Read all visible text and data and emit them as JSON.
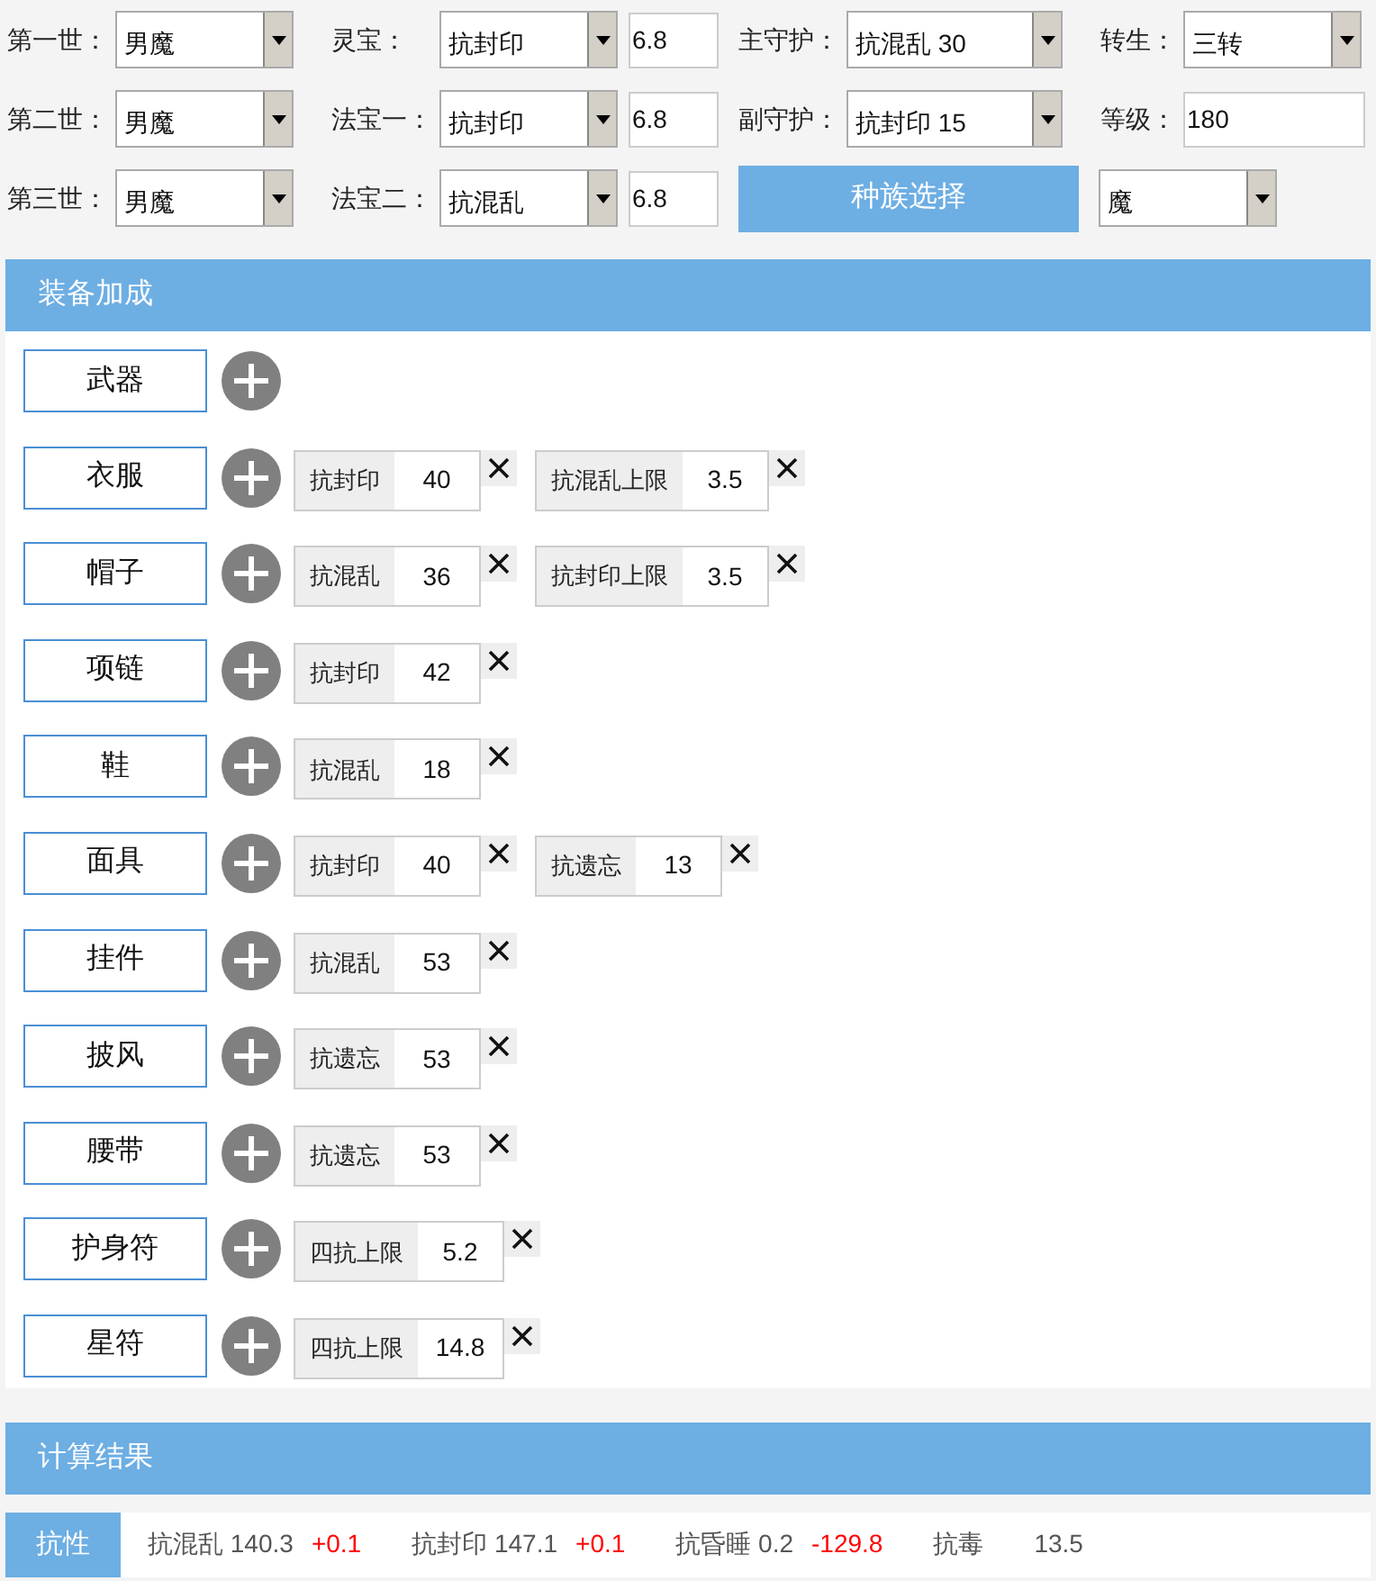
{
  "form": {
    "rows": [
      [
        {
          "kind": "label",
          "text": "第一世："
        },
        {
          "kind": "select",
          "text": "男魔"
        },
        {
          "kind": "label",
          "text": "灵宝："
        },
        {
          "kind": "select",
          "text": "抗封印"
        },
        {
          "kind": "input",
          "text": "6.8"
        },
        {
          "kind": "label",
          "text": "主守护："
        },
        {
          "kind": "wideselect",
          "text": "抗混乱 30"
        },
        {
          "kind": "label",
          "text": "转生："
        },
        {
          "kind": "select",
          "text": "三转"
        }
      ],
      [
        {
          "kind": "label",
          "text": "第二世："
        },
        {
          "kind": "select",
          "text": "男魔"
        },
        {
          "kind": "label",
          "text": "法宝一："
        },
        {
          "kind": "select",
          "text": "抗封印"
        },
        {
          "kind": "input",
          "text": "6.8"
        },
        {
          "kind": "label",
          "text": "副守护："
        },
        {
          "kind": "wideselect",
          "text": "抗封印 15"
        },
        {
          "kind": "label",
          "text": "等级："
        },
        {
          "kind": "wideinput",
          "text": "180"
        }
      ],
      [
        {
          "kind": "label",
          "text": "第三世："
        },
        {
          "kind": "select",
          "text": "男魔"
        },
        {
          "kind": "label",
          "text": "法宝二："
        },
        {
          "kind": "select",
          "text": "抗混乱"
        },
        {
          "kind": "input",
          "text": "6.8"
        }
      ]
    ],
    "race_button": "种族选择",
    "race_select": "魔"
  },
  "equipment": {
    "title": "装备加成",
    "slots": [
      {
        "name": "武器"
      },
      {
        "name": "衣服",
        "attributes": [
          {
            "name": "抗封印",
            "value": "40"
          },
          {
            "name": "抗混乱上限",
            "value": "3.5"
          }
        ]
      },
      {
        "name": "帽子",
        "attributes": [
          {
            "name": "抗混乱",
            "value": "36"
          },
          {
            "name": "抗封印上限",
            "value": "3.5"
          }
        ]
      },
      {
        "name": "项链",
        "attributes": [
          {
            "name": "抗封印",
            "value": "42"
          }
        ]
      },
      {
        "name": "鞋",
        "attributes": [
          {
            "name": "抗混乱",
            "value": "18"
          }
        ]
      },
      {
        "name": "面具",
        "attributes": [
          {
            "name": "抗封印",
            "value": "40"
          },
          {
            "name": "抗遗忘",
            "value": "13"
          }
        ]
      },
      {
        "name": "挂件",
        "attributes": [
          {
            "name": "抗混乱",
            "value": "53"
          }
        ]
      },
      {
        "name": "披风",
        "attributes": [
          {
            "name": "抗遗忘",
            "value": "53"
          }
        ]
      },
      {
        "name": "腰带",
        "attributes": [
          {
            "name": "抗遗忘",
            "value": "53"
          }
        ]
      },
      {
        "name": "护身符",
        "attributes": [
          {
            "name": "四抗上限",
            "value": "5.2"
          }
        ]
      },
      {
        "name": "星符",
        "attributes": [
          {
            "name": "四抗上限",
            "value": "14.8"
          }
        ]
      }
    ]
  },
  "results": {
    "title": "计算结果",
    "tab": "抗性",
    "items": [
      {
        "text": "抗混乱 140.3",
        "delta": "+0.1"
      },
      {
        "text": "抗封印 147.1",
        "delta": "+0.1"
      },
      {
        "text": "抗昏睡 0.2",
        "delta": "-129.8"
      },
      {
        "text": "抗毒"
      },
      {
        "text": "13.5"
      }
    ]
  }
}
